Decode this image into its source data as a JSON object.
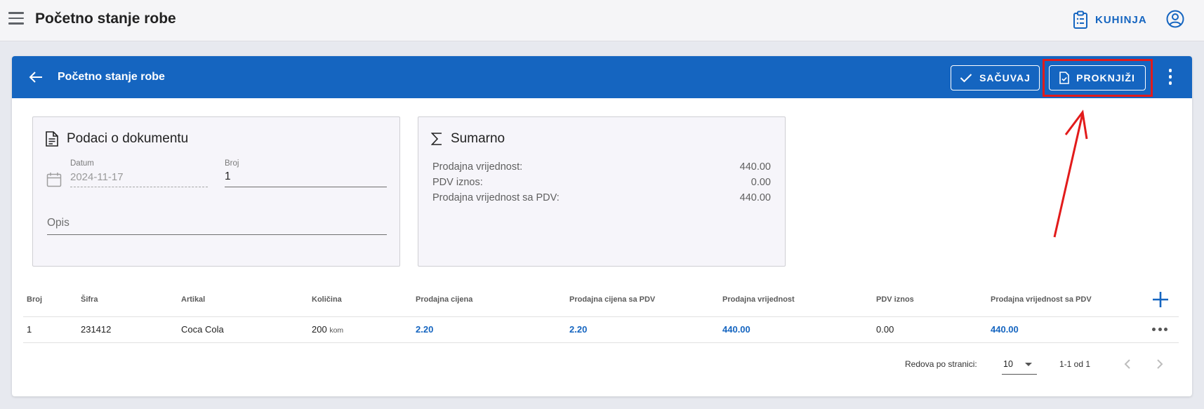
{
  "app": {
    "title": "Početno stanje robe",
    "kuhinja_label": "KUHINJA"
  },
  "colors": {
    "primary": "#1565c0",
    "highlight": "#e21b1b",
    "panel_bg": "#f6f5fa"
  },
  "card": {
    "title": "Početno stanje robe",
    "save_label": "SAČUVAJ",
    "post_label": "PROKNJIŽI"
  },
  "document": {
    "heading": "Podaci o dokumentu",
    "date_label": "Datum",
    "date_value": "2024-11-17",
    "number_label": "Broj",
    "number_value": "1",
    "description_placeholder": "Opis"
  },
  "summary": {
    "heading": "Sumarno",
    "rows": [
      {
        "label": "Prodajna vrijednost:",
        "value": "440.00"
      },
      {
        "label": "PDV iznos:",
        "value": "0.00"
      },
      {
        "label": "Prodajna vrijednost sa PDV:",
        "value": "440.00"
      }
    ]
  },
  "table": {
    "headers": [
      "Broj",
      "Šifra",
      "Artikal",
      "Količina",
      "Prodajna cijena",
      "Prodajna cijena sa PDV",
      "Prodajna vrijednost",
      "PDV iznos",
      "Prodajna vrijednost sa PDV"
    ],
    "rows": [
      {
        "broj": "1",
        "sifra": "231412",
        "artikal": "Coca Cola",
        "kolicina": "200",
        "jedinica": "kom",
        "prodajna_cijena": "2.20",
        "prodajna_cijena_pdv": "2.20",
        "prodajna_vrijednost": "440.00",
        "pdv_iznos": "0.00",
        "prodajna_vrijednost_pdv": "440.00"
      }
    ]
  },
  "pagination": {
    "rows_per_page_label": "Redova po stranici:",
    "rows_per_page_value": "10",
    "range_text": "1-1 od 1"
  },
  "icons": {
    "menu": "hamburger-icon",
    "kuhinja": "clipboard-list-icon",
    "account": "account-circle-icon",
    "back": "arrow-left-icon",
    "save": "check-icon",
    "post": "document-check-icon",
    "more": "more-vertical-icon",
    "document": "document-icon",
    "summary": "sigma-icon",
    "calendar": "calendar-icon",
    "add": "plus-icon",
    "row_more": "more-horizontal-icon",
    "prev": "chevron-left-icon",
    "next": "chevron-right-icon"
  }
}
